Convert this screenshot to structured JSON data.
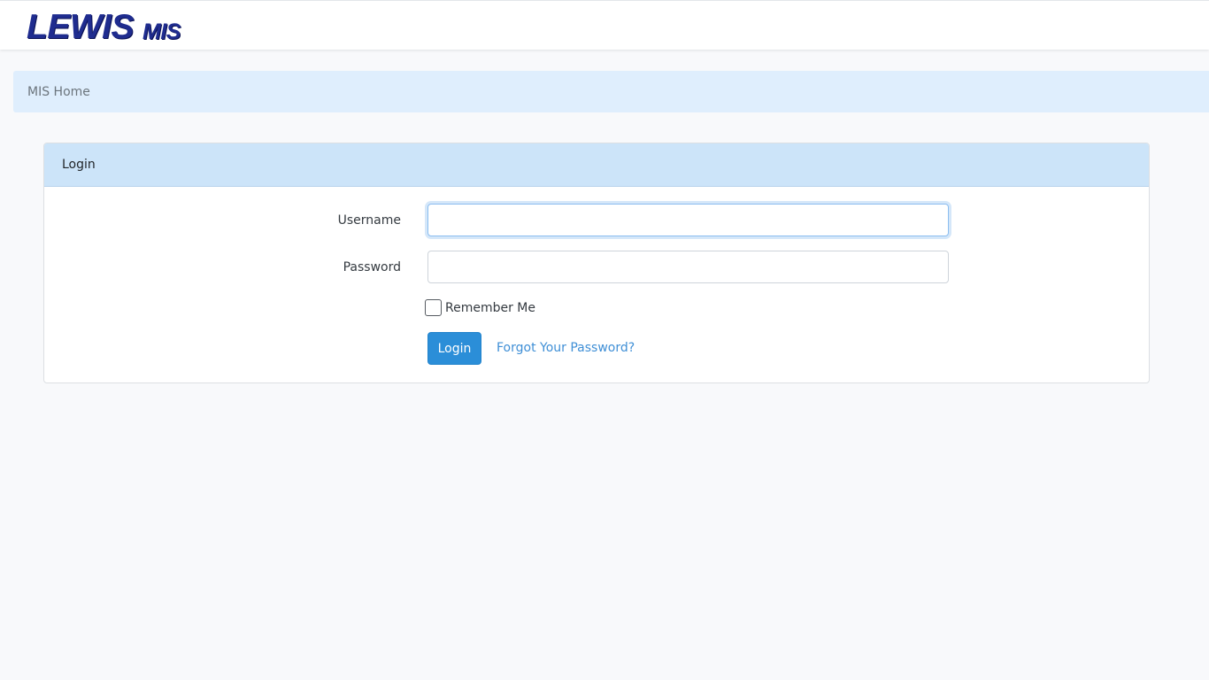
{
  "navbar": {
    "brand_main": "LEWIS",
    "brand_sub": "MIS"
  },
  "breadcrumb": {
    "items": [
      "MIS Home"
    ]
  },
  "login_card": {
    "title": "Login",
    "username_label": "Username",
    "username_value": "",
    "password_label": "Password",
    "password_value": "",
    "remember_label": "Remember Me",
    "remember_checked": false,
    "login_button": "Login",
    "forgot_link": "Forgot Your Password?"
  },
  "colors": {
    "brand": "#1f2c8f",
    "breadcrumb_bg": "#dfeefd",
    "card_header_bg": "#cce4f9",
    "primary_button": "#2b8ed8",
    "link": "#3f8fd6"
  }
}
